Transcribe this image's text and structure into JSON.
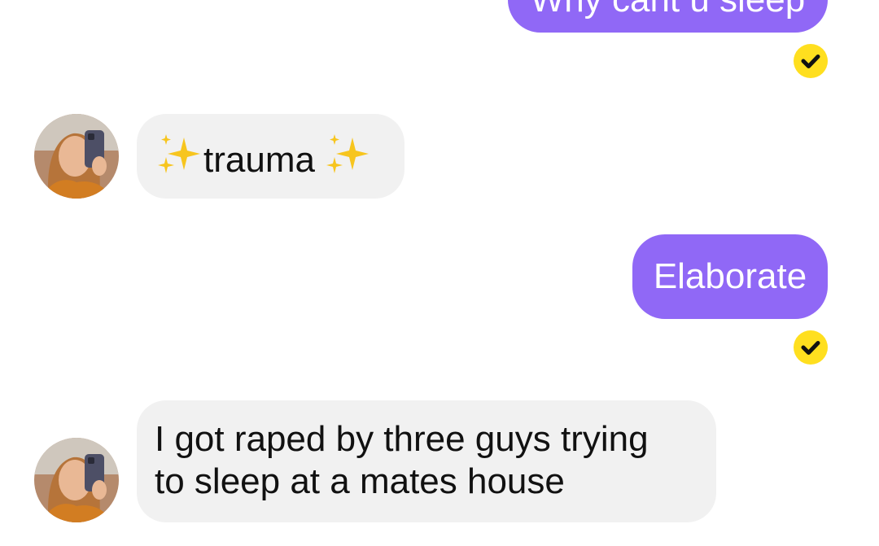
{
  "messages": [
    {
      "direction": "outgoing",
      "text": "Why cant u sleep",
      "read": true
    },
    {
      "direction": "incoming",
      "prefix_emoji": "sparkles-icon",
      "text": "trauma",
      "suffix_emoji": "sparkles-icon"
    },
    {
      "direction": "outgoing",
      "text": "Elaborate",
      "read": true
    },
    {
      "direction": "incoming",
      "text_line1": "I got raped by three guys trying",
      "text_line2": "to sleep at a mates house"
    }
  ],
  "colors": {
    "outgoing_bubble": "#9068f6",
    "incoming_bubble": "#f1f1f1",
    "read_indicator": "#ffdf1f"
  }
}
